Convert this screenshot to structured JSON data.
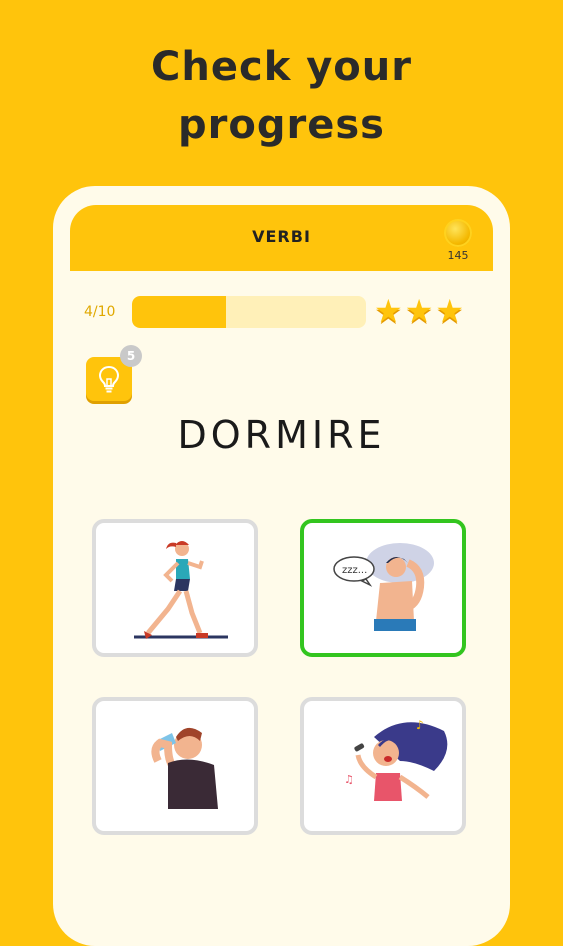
{
  "promo": {
    "headline_line1": "Check your",
    "headline_line2": "progress"
  },
  "topbar": {
    "title": "VERBI",
    "coin_icon": "coin-icon",
    "coins": "145"
  },
  "progress": {
    "label": "4/10",
    "fraction": 0.4,
    "stars": 3
  },
  "hint": {
    "icon": "lightbulb-icon",
    "badge": "5"
  },
  "question": {
    "word": "DORMIRE"
  },
  "answers": [
    {
      "illustration": "running-woman",
      "selected": false
    },
    {
      "illustration": "sleeping-man",
      "selected": true,
      "caption": "zzz..."
    },
    {
      "illustration": "man-drinking-water",
      "selected": false
    },
    {
      "illustration": "woman-singing",
      "selected": false
    }
  ],
  "colors": {
    "background": "#FFC40C",
    "screen": "#FFFBEA",
    "selected_border": "#33C51F",
    "card_border": "#DCDCDC"
  }
}
